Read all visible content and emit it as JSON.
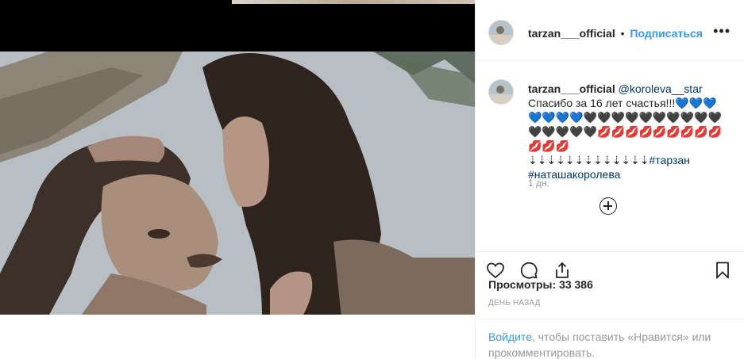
{
  "post": {
    "username": "tarzan___official",
    "follow_label": "Подписаться",
    "separator": "•",
    "more_label": "•••"
  },
  "comment": {
    "username": "tarzan___official",
    "mention": "@koroleva__star",
    "text_line1": "Спасибо за 16 лет счастья!!!",
    "emoji_blue_hearts": "💙💙💙💙💙💙💙",
    "emoji_black_hearts": "🖤🖤🖤🖤🖤🖤🖤🖤🖤🖤🖤🖤🖤🖤🖤",
    "emoji_lips": "💋💋💋💋💋💋💋💋💋💋💋💋",
    "emoji_down": "⇣⇣⇣⇣⇣⇣⇣⇣⇣⇣⇣⇣⇣",
    "hashtag1": "#тарзан",
    "hashtag2": "#наташакоролева",
    "time": "1 дн."
  },
  "stats": {
    "views_label": "Просмотры:",
    "views_value": "33 386",
    "posted": "ДЕНЬ НАЗАД"
  },
  "login": {
    "link": "Войдите",
    "rest": ", чтобы поставить «Нравится» или прокомментировать."
  },
  "icons": [
    "heart-icon",
    "comment-icon",
    "share-icon",
    "bookmark-icon",
    "more-icon",
    "add-comments-icon"
  ],
  "colors": {
    "link_blue": "#3897f0",
    "mention_blue": "#003569",
    "muted": "#999999"
  }
}
